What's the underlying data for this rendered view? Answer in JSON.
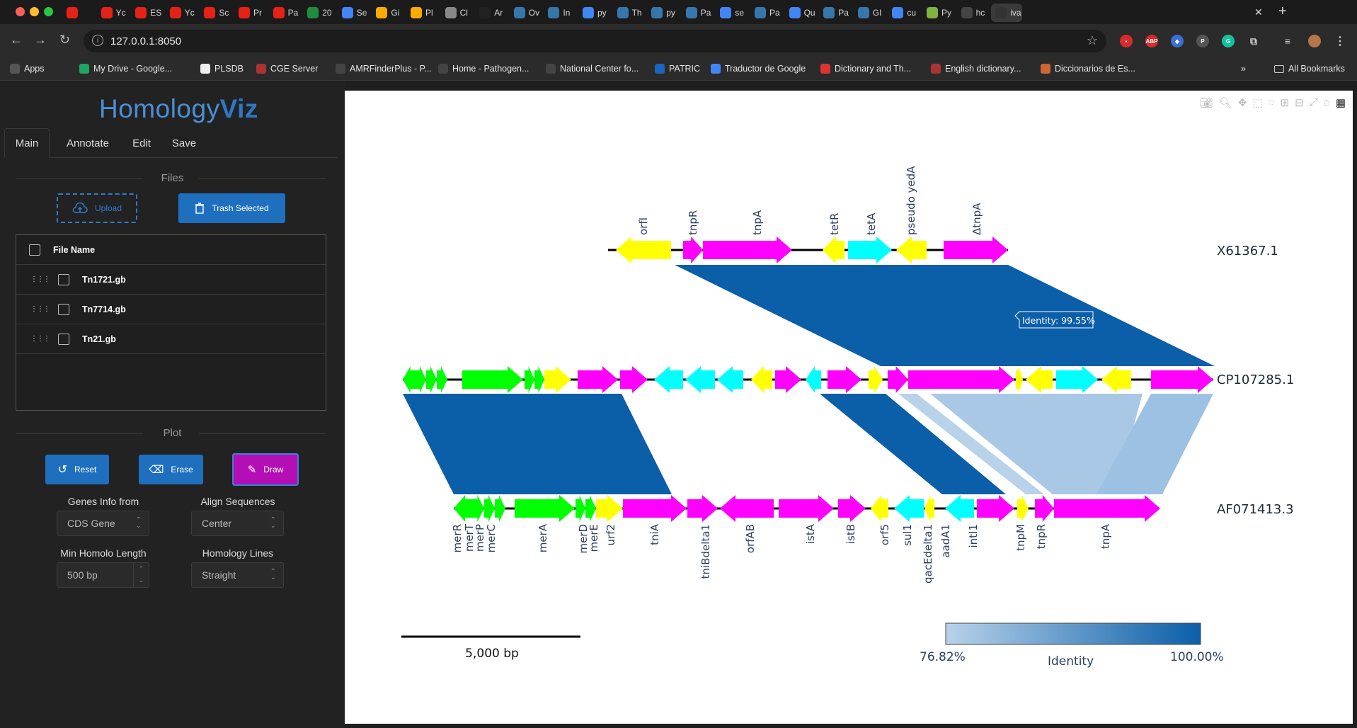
{
  "browser": {
    "url": "127.0.0.1:8050",
    "tabs": [
      "",
      "Yc",
      "ES",
      "Yc",
      "Sc",
      "Pr",
      "Pa",
      "20",
      "Se",
      "Gi",
      "Pl",
      "Cl",
      "Ar",
      "Ov",
      "In",
      "py",
      "Th",
      "py",
      "Pa",
      "se",
      "Pa",
      "Qu",
      "Pa",
      "GI",
      "cu",
      "Py",
      "hc",
      "iva"
    ],
    "bookmarks": [
      "Apps",
      "My Drive - Google...",
      "PLSDB",
      "CGE Server",
      "AMRFinderPlus - P...",
      "Home - Pathogen...",
      "National Center fo...",
      "PATRIC",
      "Traductor de Google",
      "Dictionary and Th...",
      "English dictionary...",
      "Diccionarios de Es..."
    ],
    "all_bookmarks": "All Bookmarks",
    "overflow": "»"
  },
  "app": {
    "logo_left": "Homology",
    "logo_right": "Viz",
    "tabs": [
      "Main",
      "Annotate",
      "Edit",
      "Save"
    ],
    "files_title": "Files",
    "upload_label": "Upload",
    "trash_label": "Trash Selected",
    "file_header": "File Name",
    "files": [
      "Tn1721.gb",
      "Tn7714.gb",
      "Tn21.gb"
    ],
    "plot_title": "Plot",
    "reset_label": "Reset",
    "erase_label": "Erase",
    "draw_label": "Draw",
    "genes_info_label": "Genes Info from",
    "genes_info_value": "CDS Gene",
    "align_label": "Align Sequences",
    "align_value": "Center",
    "min_len_label": "Min Homolo Length",
    "min_len_value": "500 bp",
    "lines_label": "Homology Lines",
    "lines_value": "Straight"
  },
  "figure": {
    "sequences": [
      "X61367.1",
      "CP107285.1",
      "AF071413.3"
    ],
    "top_genes": [
      "orfI",
      "tnpR",
      "tnpA",
      "tetR",
      "tetA",
      "pseudo yedA",
      "ΔtnpA"
    ],
    "bottom_genes": [
      "merR",
      "merT",
      "merP",
      "merC",
      "merA",
      "merD",
      "merE",
      "urf2",
      "tniA",
      "tniBdelta1",
      "orfAB",
      "istA",
      "istB",
      "orf5",
      "sul1",
      "qacEdelta1",
      "aadA1",
      "intI1",
      "tnpM",
      "tnpR",
      "tnpA"
    ],
    "hover_label": "Identity: 99.55%",
    "scale_label": "5,000 bp",
    "colorbar_min": "76.82%",
    "colorbar_max": "100.00%",
    "colorbar_title": "Identity",
    "colors": {
      "yellow": "#ffff00",
      "magenta": "#ff00ff",
      "cyan": "#00ffff",
      "green": "#00ff00",
      "high_identity": "#0b5ea8",
      "low_identity": "#b8d2ea"
    }
  }
}
